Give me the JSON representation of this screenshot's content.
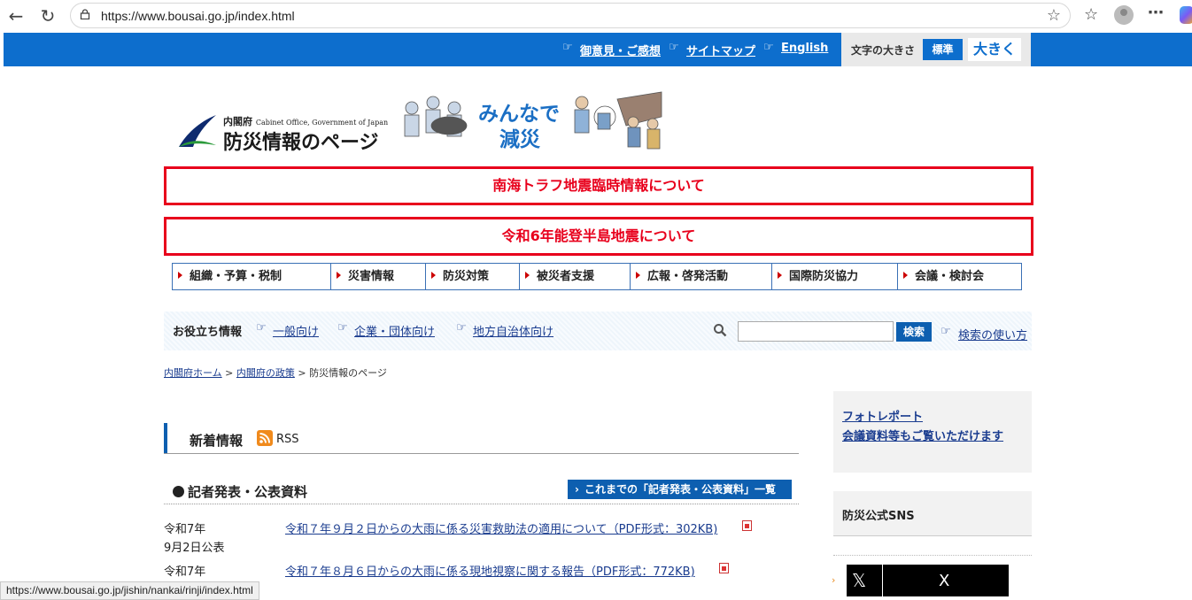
{
  "browser": {
    "url": "https://www.bousai.go.jp/index.html",
    "status_url": "https://www.bousai.go.jp/jishin/nankai/rinji/index.html"
  },
  "topbar": {
    "links": [
      "御意見・ご感想",
      "サイトマップ",
      "English"
    ],
    "font_size_label": "文字の大きさ",
    "font_standard": "標準",
    "font_large": "大きく"
  },
  "logo": {
    "org_jp": "内閣府",
    "org_en": "Cabinet Office, Government of Japan",
    "title": "防災情報のページ",
    "slogan_line1": "みんなで",
    "slogan_line2": "減災"
  },
  "notices": [
    "南海トラフ地震臨時情報について",
    "令和6年能登半島地震について"
  ],
  "nav": [
    "組織・予算・税制",
    "災害情報",
    "防災対策",
    "被災者支援",
    "広報・啓発活動",
    "国際防災協力",
    "会議・検討会"
  ],
  "useful": {
    "label": "お役立ち情報",
    "links": [
      "一般向け",
      "企業・団体向け",
      "地方自治体向け"
    ],
    "search_button": "検索",
    "search_help": "検索の使い方"
  },
  "breadcrumb": [
    "内閣府ホーム",
    "内閣府の政策",
    "防災情報のページ"
  ],
  "news": {
    "title": "新着情報",
    "rss": "RSS",
    "press_title": "記者発表・公表資料",
    "press_button": "これまでの「記者発表・公表資料」一覧",
    "items": [
      {
        "date1": "令和7年",
        "date2": "9月2日公表",
        "text": "令和７年９月２日からの大雨に係る災害救助法の適用について（PDF形式：302KB)"
      },
      {
        "date1": "令和7年",
        "date2": "",
        "text": "令和７年８月６日からの大雨に係る現地視察に関する報告（PDF形式：772KB)"
      }
    ]
  },
  "sidebar": {
    "photo_link1": "フォトレポート",
    "photo_link2": "会議資料等もご覧いただけます",
    "sns_title": "防災公式SNS",
    "x_label": "X"
  },
  "colors": {
    "brand_blue": "#0d6ecd",
    "alert_red": "#e8001c"
  }
}
